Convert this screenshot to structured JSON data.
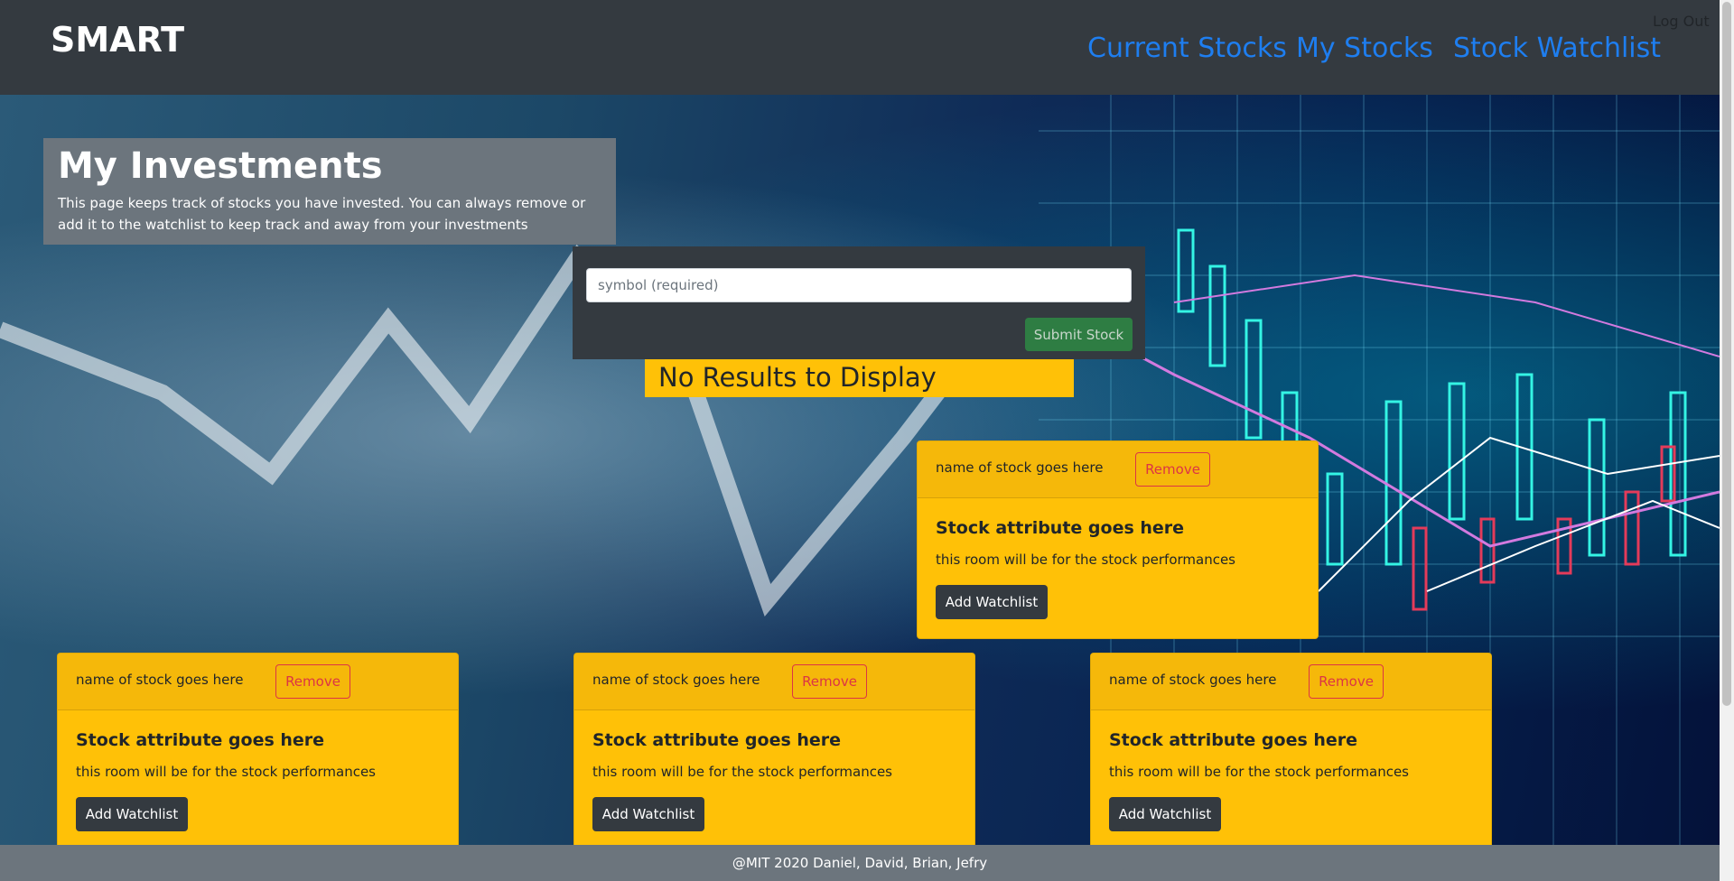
{
  "navbar": {
    "brand": "SMART",
    "logout": "Log Out",
    "links": [
      "Current Stocks",
      "My Stocks",
      "Stock Watchlist"
    ]
  },
  "jumbotron": {
    "title": "My Investments",
    "description": "This page keeps track of stocks you have invested. You can always remove or add it to the watchlist to keep track and away from your investments"
  },
  "form": {
    "symbol_placeholder": "symbol (required)",
    "submit_label": "Submit Stock"
  },
  "no_results": "No Results to Display",
  "cards": [
    {
      "name": "name of stock goes here",
      "remove_label": "Remove",
      "title": "Stock attribute goes here",
      "text": "this room will be for the stock performances",
      "watchlist_label": "Add Watchlist"
    },
    {
      "name": "name of stock goes here",
      "remove_label": "Remove",
      "title": "Stock attribute goes here",
      "text": "this room will be for the stock performances",
      "watchlist_label": "Add Watchlist"
    },
    {
      "name": "name of stock goes here",
      "remove_label": "Remove",
      "title": "Stock attribute goes here",
      "text": "this room will be for the stock performances",
      "watchlist_label": "Add Watchlist"
    },
    {
      "name": "name of stock goes here",
      "remove_label": "Remove",
      "title": "Stock attribute goes here",
      "text": "this room will be for the stock performances",
      "watchlist_label": "Add Watchlist"
    }
  ],
  "footer": "@MIT 2020 Daniel, David, Brian, Jefry",
  "colors": {
    "navbar": "#343a40",
    "link": "#1e7ef0",
    "card": "#ffc107",
    "remove": "#dc3545",
    "submit": "#2e7d43",
    "footer": "#6c757d"
  }
}
